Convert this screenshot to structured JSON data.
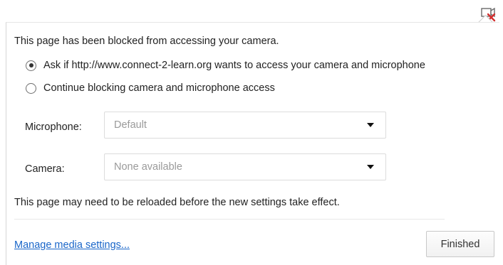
{
  "toolbar": {
    "blocked_icon": "camera-blocked-icon",
    "blocked_icon_color": "#d32f2f"
  },
  "bubble": {
    "heading": "This page has been blocked from accessing your camera.",
    "options": [
      {
        "label": "Ask if http://www.connect-2-learn.org wants to access your camera and microphone",
        "selected": true
      },
      {
        "label": "Continue blocking camera and microphone access",
        "selected": false
      }
    ],
    "microphone": {
      "label": "Microphone:",
      "value": "Default",
      "icon": "chevron-down-icon"
    },
    "camera": {
      "label": "Camera:",
      "value": "None available",
      "icon": "chevron-down-icon"
    },
    "reload_note": "This page may need to be reloaded before the new settings take effect.",
    "manage_link": "Manage media settings...",
    "finished_button": "Finished",
    "link_color": "#1a66c9"
  }
}
